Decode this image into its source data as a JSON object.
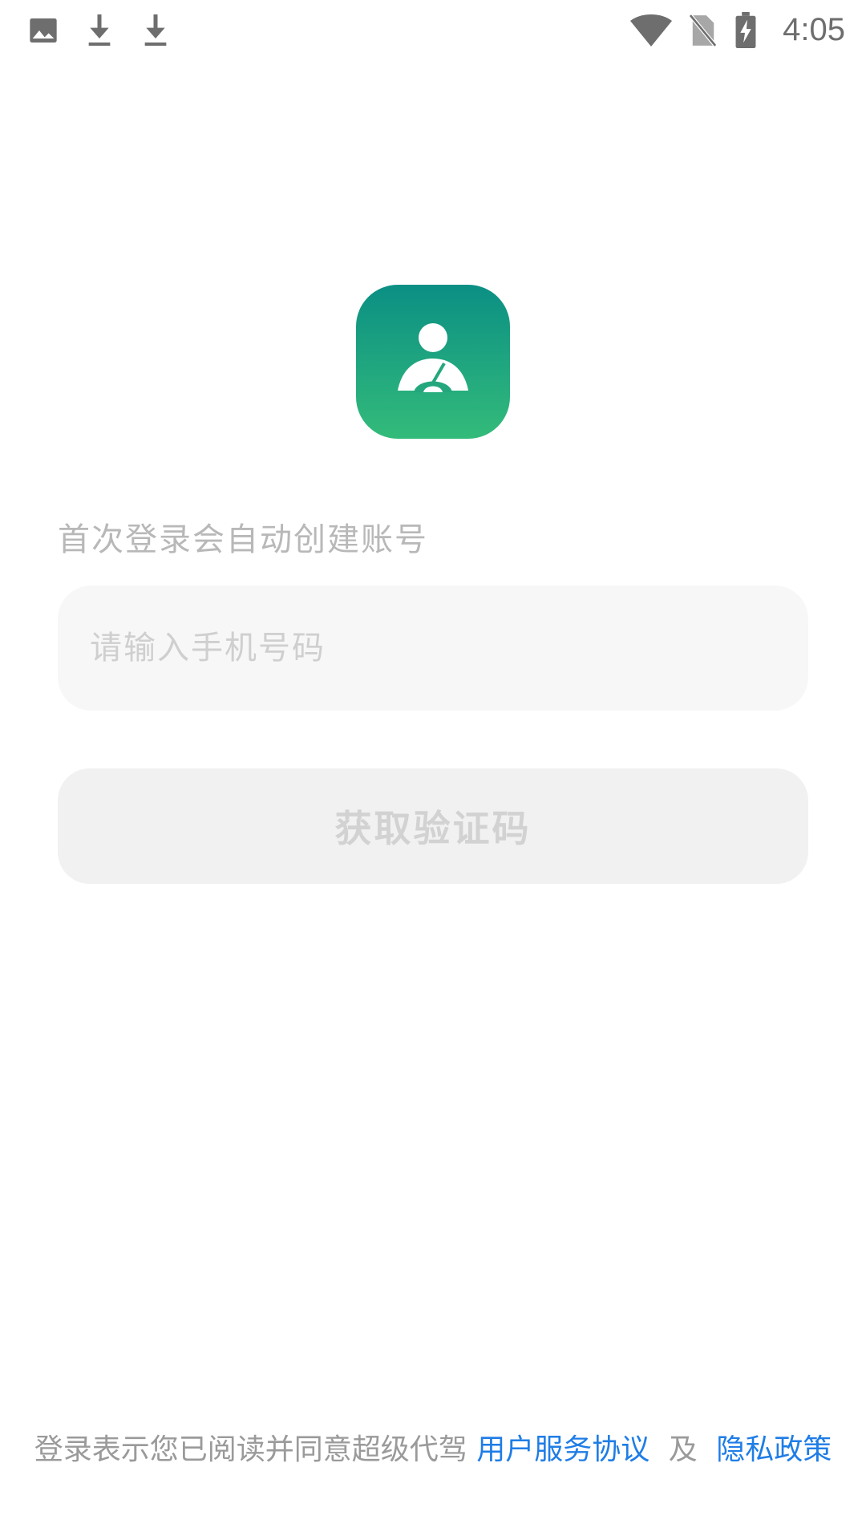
{
  "status_bar": {
    "time": "4:05",
    "left_icons": [
      "image-icon",
      "download-icon",
      "download-icon"
    ],
    "right_icons": [
      "wifi-icon",
      "no-sim-icon",
      "battery-charging-icon"
    ]
  },
  "logo": {
    "icon": "driver-steering-wheel-icon",
    "gradient_top": "#0b8f84",
    "gradient_bottom": "#33bb7a"
  },
  "login": {
    "hint": "首次登录会自动创建账号",
    "phone_placeholder": "请输入手机号码",
    "phone_value": "",
    "get_code_label": "获取验证码"
  },
  "agreement": {
    "prefix": "登录表示您已阅读并同意超级代驾",
    "user_agreement": "用户服务协议",
    "conjunction": "及",
    "privacy_policy": "隐私政策",
    "link_color": "#1f7de6"
  }
}
